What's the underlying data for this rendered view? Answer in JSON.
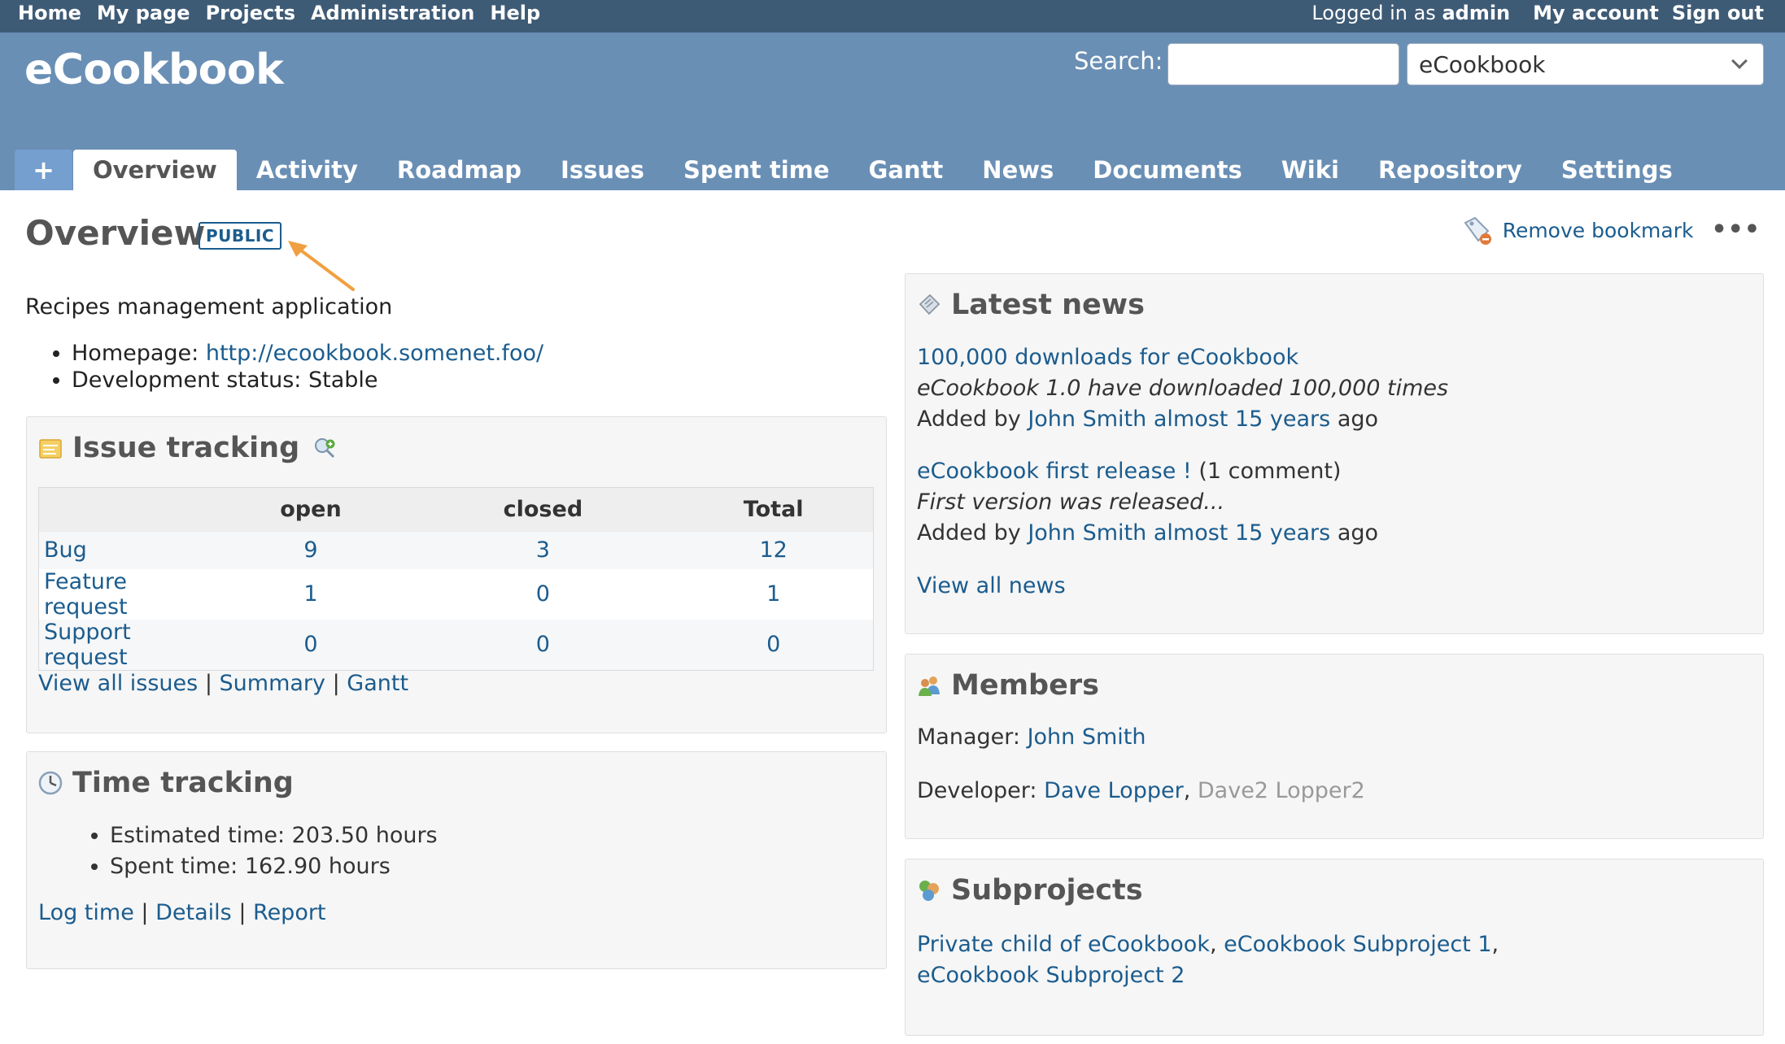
{
  "top_menu": {
    "home": "Home",
    "my_page": "My page",
    "projects": "Projects",
    "administration": "Administration",
    "help": "Help",
    "logged_prefix": "Logged in as",
    "logged_user": "admin",
    "my_account": "My account",
    "sign_out": "Sign out"
  },
  "header": {
    "project_title": "eCookbook",
    "search_label": "Search:",
    "search_value": "",
    "project_select": "eCookbook"
  },
  "tabs": {
    "plus": "+",
    "items": [
      "Overview",
      "Activity",
      "Roadmap",
      "Issues",
      "Spent time",
      "Gantt",
      "News",
      "Documents",
      "Wiki",
      "Repository",
      "Settings"
    ],
    "selected": "Overview"
  },
  "page": {
    "title": "Overview",
    "badge": "PUBLIC",
    "remove_bookmark": "Remove bookmark",
    "more": "•••",
    "description": "Recipes management application",
    "homepage_label": "Homepage:",
    "homepage_url": "http://ecookbook.somenet.foo/",
    "dev_status": "Development status: Stable"
  },
  "issue_tracking": {
    "title": "Issue tracking",
    "columns": [
      "",
      "open",
      "closed",
      "Total"
    ],
    "rows": [
      {
        "tracker": "Bug",
        "open": "9",
        "closed": "3",
        "total": "12"
      },
      {
        "tracker": "Feature request",
        "open": "1",
        "closed": "0",
        "total": "1"
      },
      {
        "tracker": "Support request",
        "open": "0",
        "closed": "0",
        "total": "0"
      }
    ],
    "links": {
      "view_all": "View all issues",
      "summary": "Summary",
      "gantt": "Gantt",
      "sep": "|"
    }
  },
  "time_tracking": {
    "title": "Time tracking",
    "estimated": "Estimated time: 203.50 hours",
    "spent": "Spent time: 162.90 hours",
    "links": {
      "log_time": "Log time",
      "details": "Details",
      "report": "Report",
      "sep": "|"
    }
  },
  "latest_news": {
    "title": "Latest news",
    "items": [
      {
        "title": "100,000 downloads for eCookbook",
        "comments": "",
        "summary": "eCookbook 1.0 have downloaded 100,000 times",
        "added_by": "Added by",
        "author": "John Smith",
        "age": "almost 15 years",
        "ago": "ago"
      },
      {
        "title": "eCookbook first release !",
        "comments": "(1 comment)",
        "summary": "First version was released...",
        "added_by": "Added by",
        "author": "John Smith",
        "age": "almost 15 years",
        "ago": "ago"
      }
    ],
    "view_all": "View all news"
  },
  "members": {
    "title": "Members",
    "manager_label": "Manager:",
    "manager": "John Smith",
    "developer_label": "Developer:",
    "developer_1": "Dave Lopper",
    "developer_sep": ",",
    "developer_2": "Dave2 Lopper2"
  },
  "subprojects": {
    "title": "Subprojects",
    "items": [
      "Private child of eCookbook",
      "eCookbook Subproject 1",
      "eCookbook Subproject 2"
    ],
    "sep": ","
  },
  "colors": {
    "top_menu_bg": "#3e5b76",
    "header_bg": "#6a8fb5",
    "link": "#1b5c8e",
    "annotation_arrow": "#f0a040"
  }
}
